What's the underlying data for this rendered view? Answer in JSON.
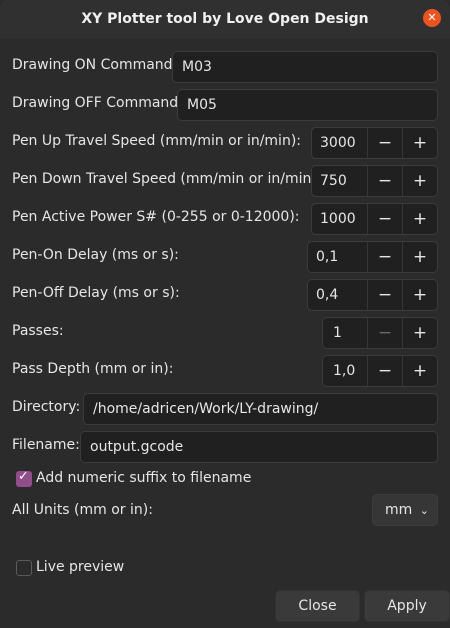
{
  "window": {
    "title": "XY Plotter tool by Love Open Design"
  },
  "fields": {
    "drawing_on": {
      "label": "Drawing ON Command:",
      "value": "M03"
    },
    "drawing_off": {
      "label": "Drawing OFF Command:",
      "value": "M05"
    },
    "pen_up_speed": {
      "label": "Pen Up Travel Speed (mm/min or in/min):",
      "value": "3000"
    },
    "pen_down_speed": {
      "label": "Pen Down Travel Speed  (mm/min or in/min):",
      "value": "750"
    },
    "pen_power": {
      "label": "Pen Active Power S# (0-255 or 0-12000):",
      "value": "1000"
    },
    "pen_on_delay": {
      "label": "Pen-On Delay (ms or s):",
      "value": "0,1"
    },
    "pen_off_delay": {
      "label": "Pen-Off Delay (ms or s):",
      "value": "0,4"
    },
    "passes": {
      "label": "Passes:",
      "value": "1"
    },
    "pass_depth": {
      "label": "Pass Depth (mm or in):",
      "value": "1,0"
    },
    "directory": {
      "label": "Directory:",
      "value": "/home/adricen/Work/LY-drawing/"
    },
    "filename": {
      "label": "Filename:",
      "value": "output.gcode"
    },
    "numeric_suffix": {
      "label": "Add numeric suffix to filename",
      "checked": true
    },
    "units": {
      "label": "All Units (mm or in):",
      "value": "mm"
    },
    "live_preview": {
      "label": "Live preview",
      "checked": false
    }
  },
  "spin_glyphs": {
    "minus": "−",
    "plus": "+"
  },
  "buttons": {
    "close": "Close",
    "apply": "Apply"
  },
  "colors": {
    "accent_close": "#e95420",
    "checkbox_on": "#924d8b"
  }
}
